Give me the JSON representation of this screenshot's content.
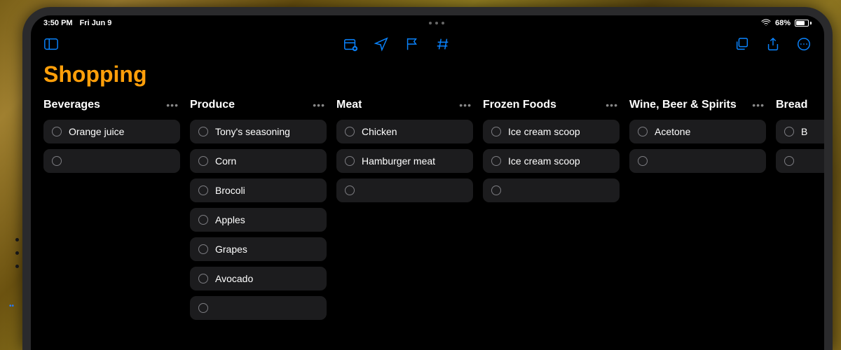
{
  "status": {
    "time": "3:50 PM",
    "date": "Fri Jun 9",
    "battery_pct": "68%"
  },
  "title": "Shopping",
  "columns": [
    {
      "name": "Beverages",
      "items": [
        "Orange juice",
        ""
      ]
    },
    {
      "name": "Produce",
      "items": [
        "Tony's seasoning",
        "Corn",
        "Brocoli",
        "Apples",
        "Grapes",
        "Avocado",
        ""
      ]
    },
    {
      "name": "Meat",
      "items": [
        "Chicken",
        "Hamburger meat",
        ""
      ]
    },
    {
      "name": "Frozen Foods",
      "items": [
        "Ice cream scoop",
        "Ice cream scoop",
        ""
      ]
    },
    {
      "name": "Wine, Beer & Spirits",
      "items": [
        "Acetone",
        ""
      ]
    },
    {
      "name": "Bread",
      "items": [
        "B",
        ""
      ]
    }
  ]
}
